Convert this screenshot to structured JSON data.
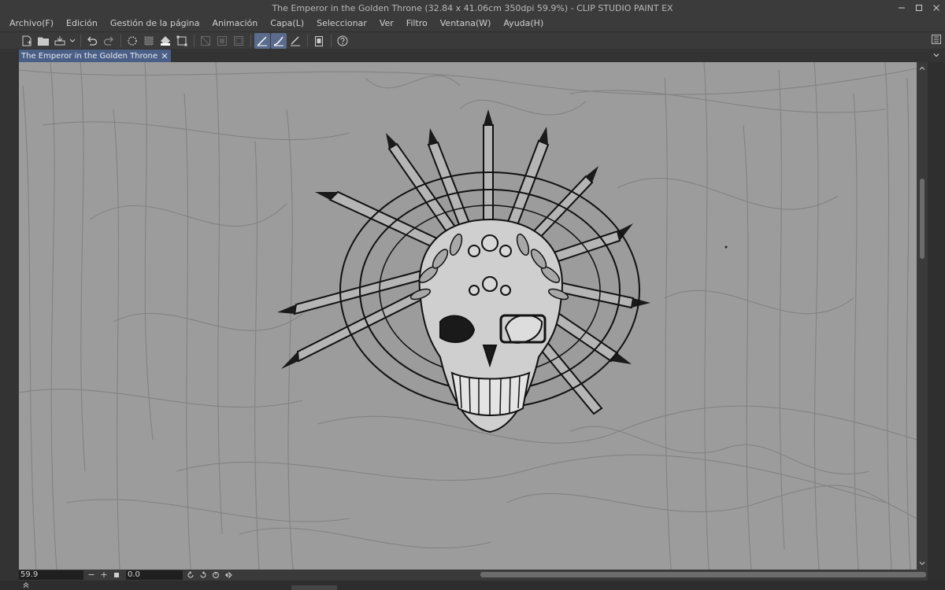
{
  "window": {
    "title": "The Emperor in the Golden Throne (32.84 x 41.06cm 350dpi 59.9%)  - CLIP STUDIO PAINT EX"
  },
  "menu": {
    "items": [
      "Archivo(F)",
      "Edición",
      "Gestión de la página",
      "Animación",
      "Capa(L)",
      "Seleccionar",
      "Ver",
      "Filtro",
      "Ventana(W)",
      "Ayuda(H)"
    ]
  },
  "toolbar": {
    "icons": [
      "new-canvas-icon",
      "open-folder-icon",
      "save-icon",
      "dropdown-icon",
      "undo-icon",
      "redo-icon",
      "loading-spinner-icon",
      "clear-selection-icon",
      "fill-icon",
      "transform-icon",
      "crop-off-icon",
      "layer-off-icon",
      "frame-off-icon",
      "vector-pen-icon",
      "correction-pen-icon",
      "ruler-pen-icon",
      "clipboard-icon",
      "help-icon"
    ]
  },
  "tab": {
    "label": "The Emperor in the Golden Throne"
  },
  "statusbar": {
    "zoom": "59.9",
    "rotation": "0.0"
  },
  "colors": {
    "canvas_bg": "#9c9c9c",
    "active_tab": "#4a5f86",
    "active_tool": "#5a6b8c",
    "ui_bg": "#3a3a3a"
  }
}
